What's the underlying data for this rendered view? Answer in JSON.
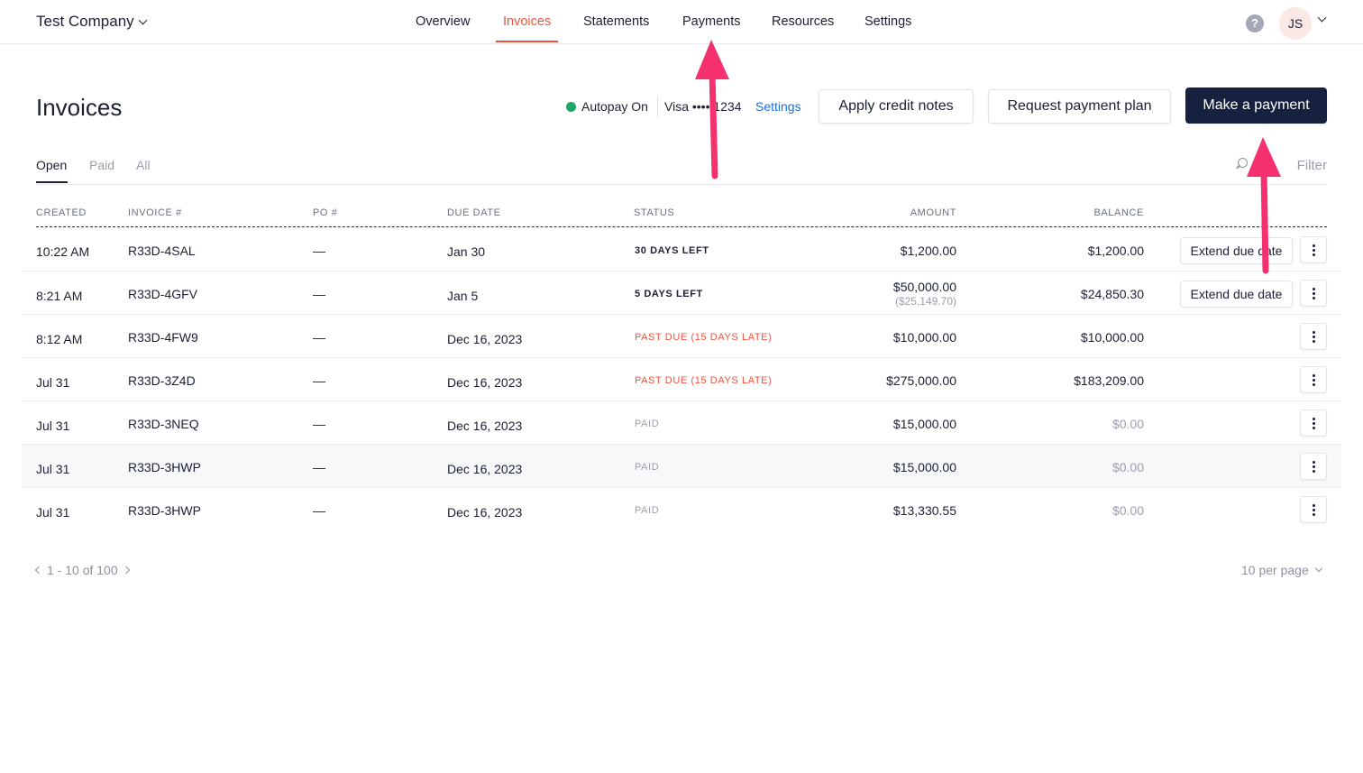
{
  "header": {
    "company": "Test Company",
    "nav": [
      {
        "label": "Overview"
      },
      {
        "label": "Invoices"
      },
      {
        "label": "Statements"
      },
      {
        "label": "Payments"
      },
      {
        "label": "Resources"
      },
      {
        "label": "Settings"
      }
    ],
    "active_nav": "Invoices",
    "help_icon": "?",
    "avatar_initials": "JS"
  },
  "page": {
    "title": "Invoices",
    "autopay_label": "Autopay On",
    "card_label": "Visa •••• 1234",
    "settings_link": "Settings",
    "actions": {
      "apply_credit": "Apply credit notes",
      "payment_plan": "Request payment plan",
      "make_payment": "Make a payment"
    }
  },
  "tabs": [
    {
      "label": "Open"
    },
    {
      "label": "Paid"
    },
    {
      "label": "All"
    }
  ],
  "filter": {
    "placeholder": "Filter"
  },
  "table": {
    "columns": [
      "CREATED",
      "INVOICE #",
      "PO #",
      "DUE DATE",
      "STATUS",
      "AMOUNT",
      "BALANCE"
    ],
    "rows": [
      {
        "created": "10:22 AM",
        "invoice": "R33D-4SAL",
        "po": "—",
        "due": "Jan 30",
        "status": "30 DAYS LEFT",
        "amount": "$1,200.00",
        "amount_sub": "",
        "balance": "$1,200.00",
        "action": "Extend due date"
      },
      {
        "created": "8:21 AM",
        "invoice": "R33D-4GFV",
        "po": "—",
        "due": "Jan 5",
        "status": "5 DAYS LEFT",
        "amount": "$50,000.00",
        "amount_sub": "($25,149.70)",
        "balance": "$24,850.30",
        "action": "Extend due date"
      },
      {
        "created": "8:12 AM",
        "invoice": "R33D-4FW9",
        "po": "—",
        "due": "Dec 16, 2023",
        "status": "PAST DUE (15 DAYS LATE)",
        "amount": "$10,000.00",
        "amount_sub": "",
        "balance": "$10,000.00",
        "action": ""
      },
      {
        "created": "Jul 31",
        "invoice": "R33D-3Z4D",
        "po": "—",
        "due": "Dec 16, 2023",
        "status": "PAST DUE (15 DAYS LATE)",
        "amount": "$275,000.00",
        "amount_sub": "",
        "balance": "$183,209.00",
        "action": ""
      },
      {
        "created": "Jul 31",
        "invoice": "R33D-3NEQ",
        "po": "—",
        "due": "Dec 16, 2023",
        "status": "PAID",
        "amount": "$15,000.00",
        "amount_sub": "",
        "balance": "$0.00",
        "action": ""
      },
      {
        "created": "Jul 31",
        "invoice": "R33D-3HWP",
        "po": "—",
        "due": "Dec 16, 2023",
        "status": "PAID",
        "amount": "$15,000.00",
        "amount_sub": "",
        "balance": "$0.00",
        "action": ""
      },
      {
        "created": "Jul 31",
        "invoice": "R33D-3HWP",
        "po": "—",
        "due": "Dec 16, 2023",
        "status": "PAID",
        "amount": "$13,330.55",
        "amount_sub": "",
        "balance": "$0.00",
        "action": ""
      }
    ]
  },
  "pagination": {
    "range": "1 - 10 of 100",
    "per_page": "10 per page"
  },
  "colors": {
    "accent": "#e8553e",
    "primary_button": "#16203f",
    "link": "#1e6fd9",
    "autopay_dot": "#1fa66a",
    "annotation_arrow": "#f4306e"
  },
  "icons": [
    "chevron-down-icon",
    "help-icon",
    "search-icon",
    "kebab-menu-icon",
    "chevron-left-icon",
    "chevron-right-icon"
  ]
}
